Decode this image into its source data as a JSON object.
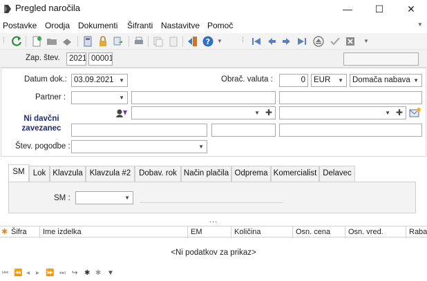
{
  "window": {
    "title": "Pregled naročila",
    "minimize": "—",
    "maximize": "☐",
    "close": "✕"
  },
  "menu": [
    "Postavke",
    "Orodja",
    "Dokumenti",
    "Šifranti",
    "Nastavitve",
    "Pomoč"
  ],
  "header": {
    "zap_label": "Zap. štev.",
    "year": "2021",
    "number": "00001"
  },
  "form": {
    "datum_label": "Datum dok.:",
    "datum_value": "03.09.2021",
    "valuta_label": "Obrač. valuta :",
    "valuta_amount": "0",
    "valuta_currency": "EUR",
    "nabava_type": "Domača nabava",
    "partner_label": "Partner :",
    "davcni_label": "Ni davčni zavezanec",
    "pogodbe_label": "Štev. pogodbe :"
  },
  "tabs": [
    "SM",
    "Lok",
    "Klavzula",
    "Klavzula #2",
    "Dobav. rok",
    "Način plačila",
    "Odprema",
    "Komercialist",
    "Delavec"
  ],
  "active_tab": "SM",
  "tab_panel": {
    "sm_label": "SM :"
  },
  "splitter": "...",
  "grid": {
    "columns": [
      "Šifra",
      "Ime izdelka",
      "EM",
      "Količina",
      "Osn. cena",
      "Osn. vred.",
      "Raba"
    ],
    "empty_text": "<Ni podatkov za prikaz>"
  },
  "colors": {
    "accent_label": "#1f2a78",
    "toolbar_bg": "#f3f3f3",
    "nav_blue": "#5b7fc1"
  }
}
